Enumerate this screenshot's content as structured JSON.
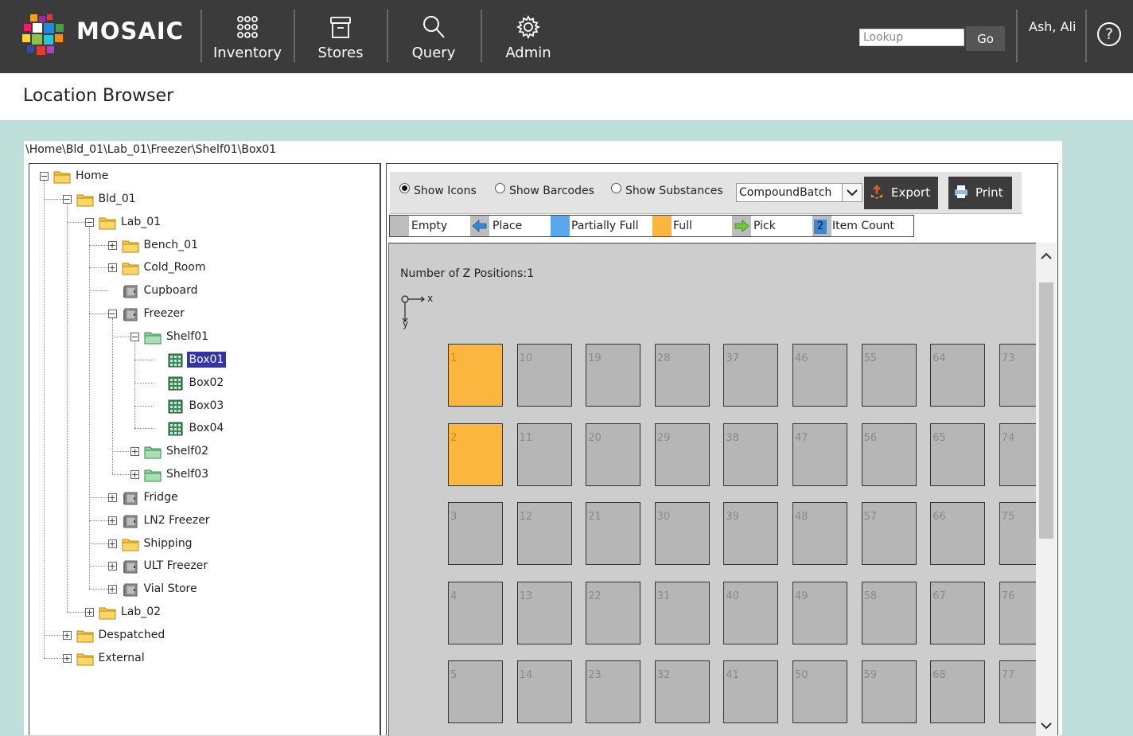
{
  "app": {
    "name": "MOSAIC"
  },
  "nav": [
    {
      "label": "Inventory",
      "icon": "inventory-grid-icon"
    },
    {
      "label": "Stores",
      "icon": "stores-box-icon"
    },
    {
      "label": "Query",
      "icon": "search-icon"
    },
    {
      "label": "Admin",
      "icon": "gear-icon"
    }
  ],
  "lookup": {
    "placeholder": "Lookup",
    "button": "Go"
  },
  "user": {
    "name": "Ash, Ali"
  },
  "help": {
    "label": "?"
  },
  "page": {
    "title": "Location Browser"
  },
  "breadcrumb": "\\Home\\Bld_01\\Lab_01\\Freezer\\Shelf01\\Box01",
  "tree": [
    {
      "label": "Home",
      "icon": "folder-icon",
      "expanded": true
    },
    {
      "label": "Bld_01",
      "icon": "folder-icon",
      "expanded": true
    },
    {
      "label": "Lab_01",
      "icon": "folder-icon",
      "expanded": true
    },
    {
      "label": "Bench_01",
      "icon": "folder-icon",
      "expanded": false
    },
    {
      "label": "Cold_Room",
      "icon": "folder-icon",
      "expanded": false
    },
    {
      "label": "Cupboard",
      "icon": "cabinet-icon"
    },
    {
      "label": "Freezer",
      "icon": "cabinet-icon",
      "expanded": true
    },
    {
      "label": "Shelf01",
      "icon": "green-folder-icon",
      "expanded": true
    },
    {
      "label": "Box01",
      "icon": "box-grid-icon",
      "selected": true
    },
    {
      "label": "Box02",
      "icon": "box-grid-icon"
    },
    {
      "label": "Box03",
      "icon": "box-grid-icon"
    },
    {
      "label": "Box04",
      "icon": "box-grid-icon"
    },
    {
      "label": "Shelf02",
      "icon": "green-folder-icon",
      "expanded": false
    },
    {
      "label": "Shelf03",
      "icon": "green-folder-icon",
      "expanded": false
    },
    {
      "label": "Fridge",
      "icon": "cabinet-icon",
      "expanded": false
    },
    {
      "label": "LN2 Freezer",
      "icon": "cabinet-icon",
      "expanded": false
    },
    {
      "label": "Shipping",
      "icon": "folder-icon",
      "expanded": false
    },
    {
      "label": "ULT Freezer",
      "icon": "cabinet-icon",
      "expanded": false
    },
    {
      "label": "Vial Store",
      "icon": "cabinet-icon",
      "expanded": false
    },
    {
      "label": "Lab_02",
      "icon": "folder-icon",
      "expanded": false
    },
    {
      "label": "Despatched",
      "icon": "folder-icon",
      "expanded": false
    },
    {
      "label": "External",
      "icon": "folder-icon",
      "expanded": false
    }
  ],
  "toolbar": {
    "radios": [
      {
        "label": "Show Icons",
        "checked": true
      },
      {
        "label": "Show Barcodes",
        "checked": false
      },
      {
        "label": "Show Substances",
        "checked": false
      }
    ],
    "select_value": "CompoundBatch",
    "export": "Export",
    "print": "Print"
  },
  "legend": [
    {
      "label": "Empty",
      "color": "#bdbdbd"
    },
    {
      "label": "Place",
      "color": "#bdbdbd",
      "icon": "left-arrow-blue-icon"
    },
    {
      "label": "Partially Full",
      "color": "#5aa8ee"
    },
    {
      "label": "Full",
      "color": "#fbb63f"
    },
    {
      "label": "Pick",
      "color": "#bdbdbd",
      "icon": "right-arrow-green-icon"
    },
    {
      "label": "Item Count",
      "color": "#bdbdbd",
      "icon": "count-badge-icon",
      "badge": "2"
    }
  ],
  "grid": {
    "z_positions": "Number of Z Positions:1",
    "axis_x": "x",
    "axis_y": "y",
    "columns": [
      [
        "1",
        "2",
        "3",
        "4",
        "5"
      ],
      [
        "10",
        "11",
        "12",
        "13",
        "14"
      ],
      [
        "19",
        "20",
        "21",
        "22",
        "23"
      ],
      [
        "28",
        "29",
        "30",
        "31",
        "32"
      ],
      [
        "37",
        "38",
        "39",
        "40",
        "41"
      ],
      [
        "46",
        "47",
        "48",
        "49",
        "50"
      ],
      [
        "55",
        "56",
        "57",
        "58",
        "59"
      ],
      [
        "64",
        "65",
        "66",
        "67",
        "68"
      ],
      [
        "73",
        "74",
        "75",
        "76",
        "77"
      ]
    ],
    "full_positions": [
      "1",
      "2"
    ]
  }
}
